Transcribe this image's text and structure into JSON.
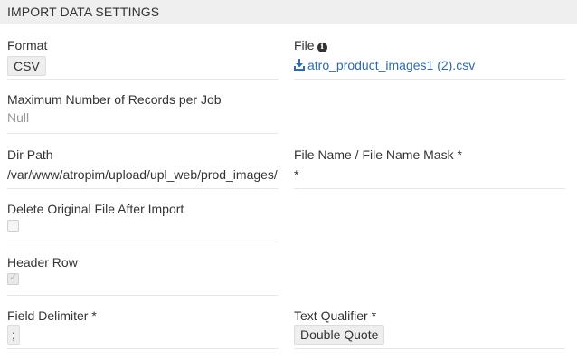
{
  "panel": {
    "title": "IMPORT DATA SETTINGS"
  },
  "format": {
    "label": "Format",
    "value": "CSV"
  },
  "file": {
    "label": "File",
    "info_icon": "info-circle-icon",
    "download_icon": "download-icon",
    "filename": "atro_product_images1 (2).csv"
  },
  "max_records": {
    "label": "Maximum Number of Records per Job",
    "value": "Null"
  },
  "dir_path": {
    "label": "Dir Path",
    "value": "/var/www/atropim/upload/upl_web/prod_images/"
  },
  "file_name_mask": {
    "label": "File Name / File Name Mask *",
    "value": "*"
  },
  "delete_original": {
    "label": "Delete Original File After Import",
    "checked": false
  },
  "header_row": {
    "label": "Header Row",
    "checked": true
  },
  "field_delimiter": {
    "label": "Field Delimiter *",
    "value": ";"
  },
  "text_qualifier": {
    "label": "Text Qualifier *",
    "value": "Double Quote"
  },
  "colors": {
    "link": "#2b6cb0",
    "header_bg": "#efefef",
    "muted": "#999999"
  }
}
